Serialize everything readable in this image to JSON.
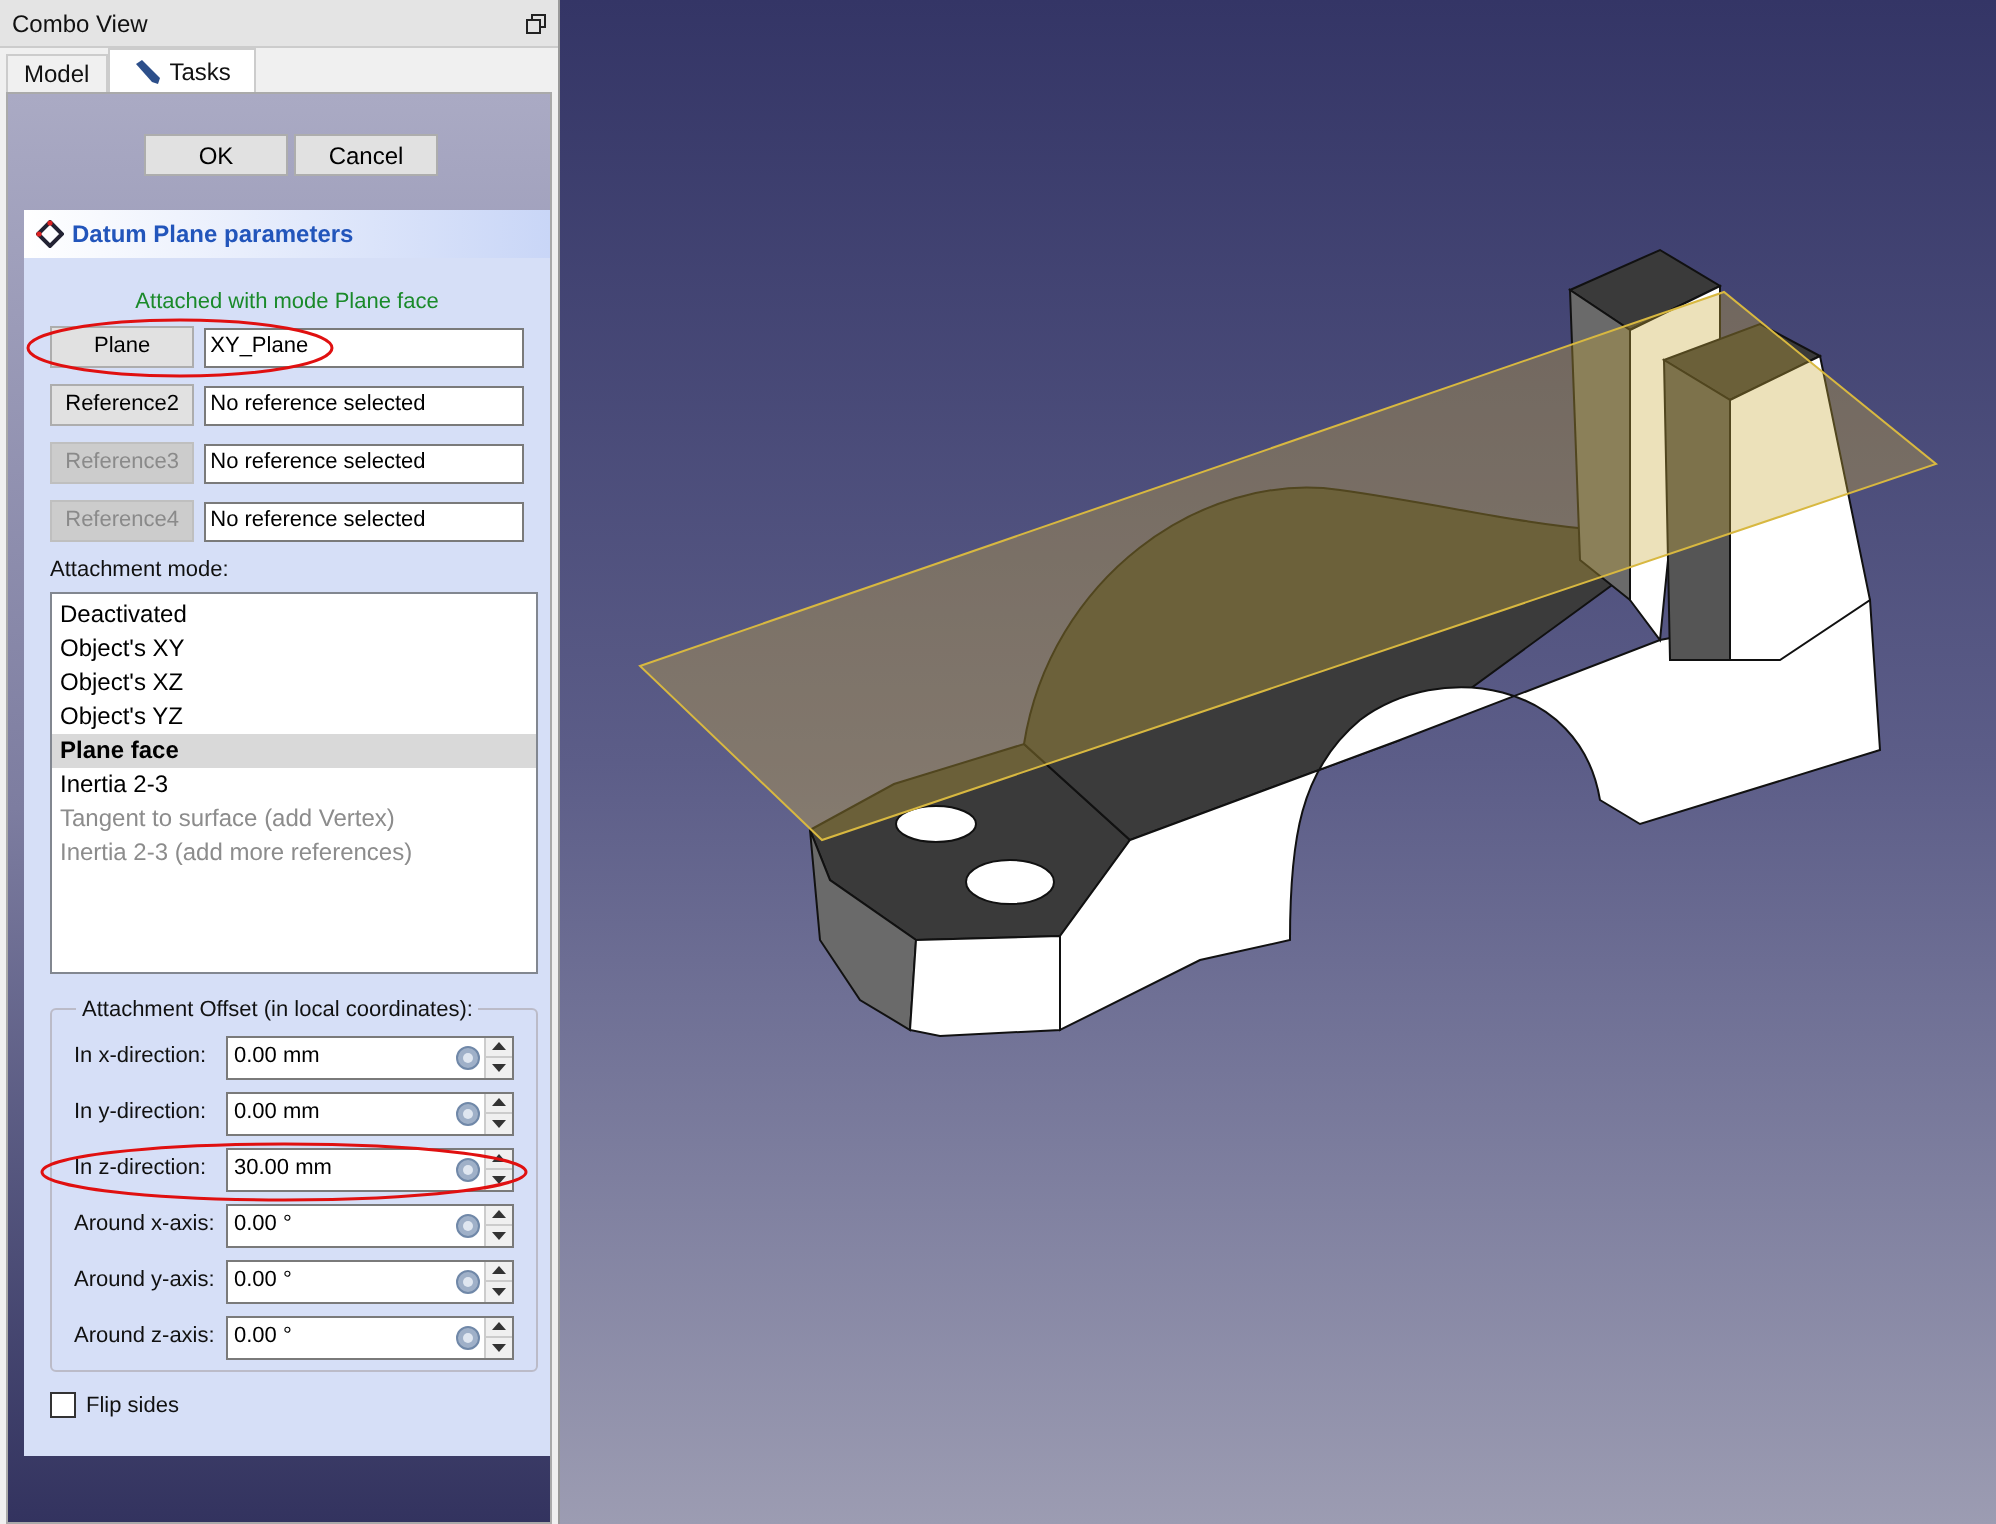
{
  "window": {
    "title": "Combo View"
  },
  "tabs": [
    {
      "label": "Model",
      "selected": false
    },
    {
      "label": "Tasks",
      "selected": true
    }
  ],
  "buttons": [
    "OK",
    "Cancel"
  ],
  "task_panel": {
    "title": "Datum Plane parameters",
    "status": "Attached with mode Plane face",
    "references": [
      {
        "button": "Plane",
        "disabled": false,
        "value": "XY_Plane"
      },
      {
        "button": "Reference2",
        "disabled": false,
        "value": "No reference selected"
      },
      {
        "button": "Reference3",
        "disabled": true,
        "value": "No reference selected"
      },
      {
        "button": "Reference4",
        "disabled": true,
        "value": "No reference selected"
      }
    ],
    "attachment_mode_label": "Attachment mode:",
    "modes": [
      {
        "label": "Deactivated",
        "selected": false,
        "disabled": false
      },
      {
        "label": "Object's XY",
        "selected": false,
        "disabled": false
      },
      {
        "label": "Object's XZ",
        "selected": false,
        "disabled": false
      },
      {
        "label": "Object's YZ",
        "selected": false,
        "disabled": false
      },
      {
        "label": "Plane face",
        "selected": true,
        "disabled": false
      },
      {
        "label": "Inertia 2-3",
        "selected": false,
        "disabled": false
      },
      {
        "label": "Tangent to surface (add Vertex)",
        "selected": false,
        "disabled": true
      },
      {
        "label": "Inertia 2-3 (add more references)",
        "selected": false,
        "disabled": true
      }
    ],
    "offset_group": {
      "title": "Attachment Offset (in local coordinates):",
      "fields": [
        {
          "label": "In x-direction:",
          "value": "0.00 mm"
        },
        {
          "label": "In y-direction:",
          "value": "0.00 mm"
        },
        {
          "label": "In z-direction:",
          "value": "30.00 mm"
        },
        {
          "label": "Around x-axis:",
          "value": "0.00 °"
        },
        {
          "label": "Around y-axis:",
          "value": "0.00 °"
        },
        {
          "label": "Around z-axis:",
          "value": "0.00 °"
        }
      ]
    },
    "flip_sides": {
      "label": "Flip sides",
      "checked": false
    }
  }
}
